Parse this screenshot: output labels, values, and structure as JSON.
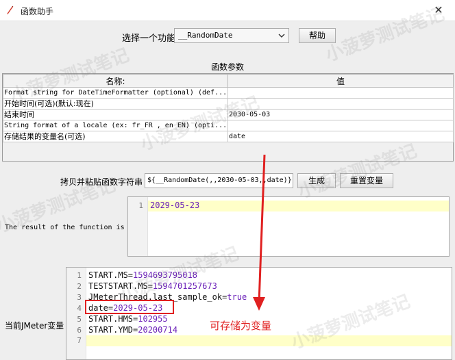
{
  "window": {
    "title": "函数助手",
    "close_glyph": "✕"
  },
  "function_select": {
    "label": "选择一个功能",
    "selected": "__RandomDate",
    "help_label": "帮助"
  },
  "params": {
    "title": "函数参数",
    "columns": [
      "名称:",
      "值"
    ],
    "rows": [
      {
        "name": "Format string for DateTimeFormatter (optional) (def...",
        "value": ""
      },
      {
        "name": "开始时间(可选)(默认:现在)",
        "value": ""
      },
      {
        "name": "结束时间",
        "value": "2030-05-03"
      },
      {
        "name": "String format of a locale (ex: fr_FR , en_EN) (opti...",
        "value": ""
      },
      {
        "name": "存储结果的变量名(可选)",
        "value": "date"
      }
    ]
  },
  "copy_row": {
    "label": "拷贝并粘贴函数字符串",
    "value": "${__RandomDate(,,2030-05-03,,date)}",
    "generate_label": "生成",
    "reset_label": "重置变量"
  },
  "result": {
    "label": "The result of the function is",
    "lines": [
      {
        "no": "1",
        "text": "2029-05-23"
      }
    ]
  },
  "vars": {
    "label": "当前JMeter变量",
    "lines": [
      {
        "no": "1",
        "key": "START.MS=",
        "val": "1594693795018"
      },
      {
        "no": "2",
        "key": "TESTSTART.MS=",
        "val": "1594701257673"
      },
      {
        "no": "3",
        "key": "JMeterThread.last_sample_ok=",
        "val": "true"
      },
      {
        "no": "4",
        "key": "date=",
        "val": "2029-05-23"
      },
      {
        "no": "5",
        "key": "START.HMS=",
        "val": "102955"
      },
      {
        "no": "6",
        "key": "START.YMD=",
        "val": "20200714"
      },
      {
        "no": "7",
        "key": "",
        "val": ""
      }
    ]
  },
  "annotation": {
    "text": "可存储为变量",
    "color": "#e02020"
  },
  "watermark": "小菠萝测试笔记"
}
